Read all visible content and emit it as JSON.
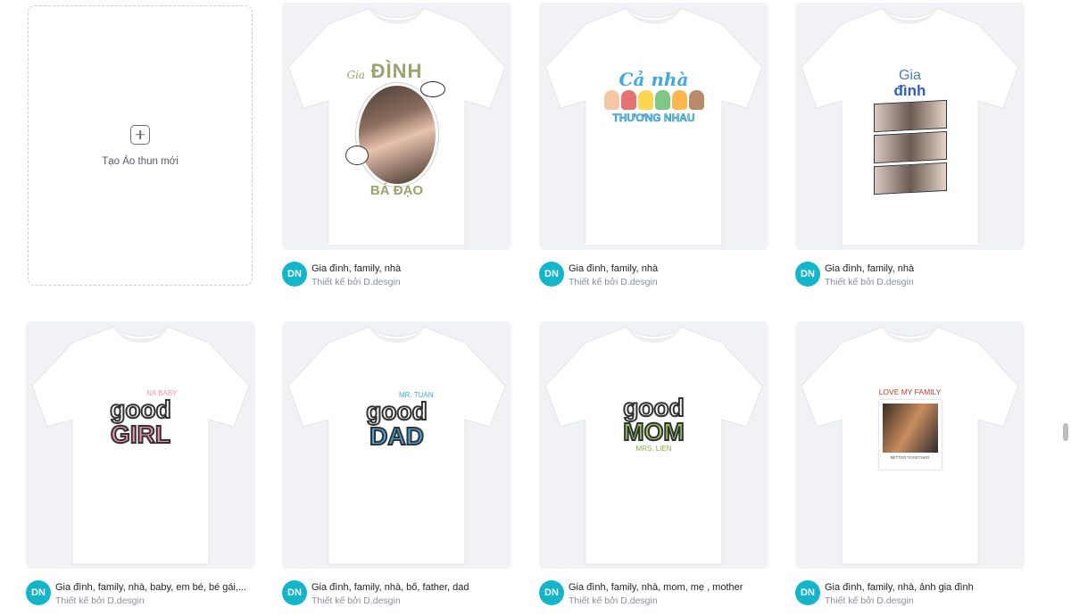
{
  "create_card": {
    "label": "Tạo Áo thun mới",
    "icon": "add-square-icon"
  },
  "cards": [
    {
      "id": "card-1",
      "title": "Gia đình, family, nhà",
      "byline": "Thiết kế bởi D.desgin",
      "avatar": "DN",
      "design": {
        "top_text": "ĐÌNH",
        "top_script": "Gia",
        "bottom_text": "BÁ ĐẠO",
        "bubble_1": "",
        "bubble_2": ""
      }
    },
    {
      "id": "card-2",
      "title": "Gia đình, family, nhà",
      "byline": "Thiết kế bởi D.desgin",
      "avatar": "DN",
      "design": {
        "top_text": "Cả nhà",
        "bottom_text": "THƯƠNG NHAU"
      }
    },
    {
      "id": "card-3",
      "title": "Gia đình, family, nhà",
      "byline": "Thiết kế bởi D.desgin",
      "avatar": "DN",
      "design": {
        "top_text": "Gia",
        "second_text": "đình"
      }
    },
    {
      "id": "card-4",
      "title": "Gia đình, family, nhà, baby, em bé, bé gái,...",
      "byline": "Thiết kế bởi D.desgin",
      "avatar": "DN",
      "design": {
        "small_text": "NA BABY",
        "line_1": "good",
        "line_2": "GIRL"
      }
    },
    {
      "id": "card-5",
      "title": "Gia đình, family, nhà, bố, father, dad",
      "byline": "Thiết kế bởi D.desgin",
      "avatar": "DN",
      "design": {
        "small_text": "MR. TUAN",
        "line_1": "good",
        "line_2": "DAD"
      }
    },
    {
      "id": "card-6",
      "title": "Gia đình, family, nhà, mom, mẹ , mother",
      "byline": "Thiết kế bởi D.desgin",
      "avatar": "DN",
      "design": {
        "small_text": "MRS. LIEN",
        "line_1": "good",
        "line_2": "MOM"
      }
    },
    {
      "id": "card-7",
      "title": "Gia đình, family, nhà, ảnh gia đình",
      "byline": "Thiết kế bởi D.desgin",
      "avatar": "DN",
      "design": {
        "top_text": "LOVE MY FAMILY",
        "caption": "BETTER TOGETHER"
      }
    }
  ],
  "colors": {
    "avatar": "#13b5cb",
    "thumb_bg": "#f1f2f6",
    "girl_pink": "#f48fb1",
    "dad_blue": "#3fa9e0",
    "mom_green": "#9ccc65",
    "title_text": "#1f1f1f",
    "byline_text": "#8a8f98"
  }
}
